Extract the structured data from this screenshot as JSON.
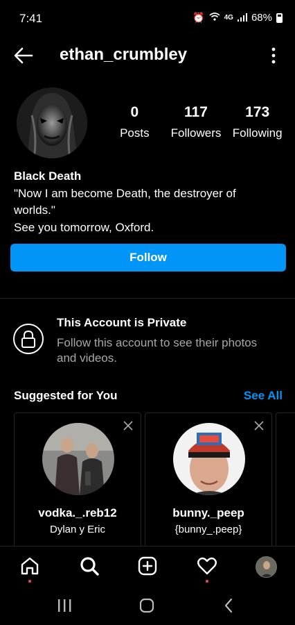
{
  "status_bar": {
    "time": "7:41",
    "network": "4G",
    "battery": "68%"
  },
  "header": {
    "username": "ethan_crumbley"
  },
  "profile": {
    "stats": [
      {
        "value": "0",
        "label": "Posts"
      },
      {
        "value": "117",
        "label": "Followers"
      },
      {
        "value": "173",
        "label": "Following"
      }
    ],
    "name": "Black Death",
    "bio_lines": [
      "\"Now I am become Death, the destroyer of",
      "worlds.\"",
      "See you tomorrow, Oxford."
    ],
    "follow_label": "Follow"
  },
  "private_notice": {
    "title": "This Account is Private",
    "subtitle": "Follow this account to see their photos and videos."
  },
  "suggested": {
    "title": "Suggested for You",
    "see_all": "See All",
    "cards": [
      {
        "username": "vodka._.reb12",
        "full_name": "Dylan y Eric"
      },
      {
        "username": "bunny._peep",
        "full_name": "{bunny_.peep}"
      }
    ]
  },
  "bottom_nav": {
    "items": [
      "home-icon",
      "search-icon",
      "new-post-icon",
      "activity-icon",
      "profile-avatar"
    ]
  },
  "colors": {
    "accent": "#0095f6",
    "notification_dot": "#ed4956",
    "secondary_text": "#a8a8a8",
    "divider": "#262626"
  }
}
